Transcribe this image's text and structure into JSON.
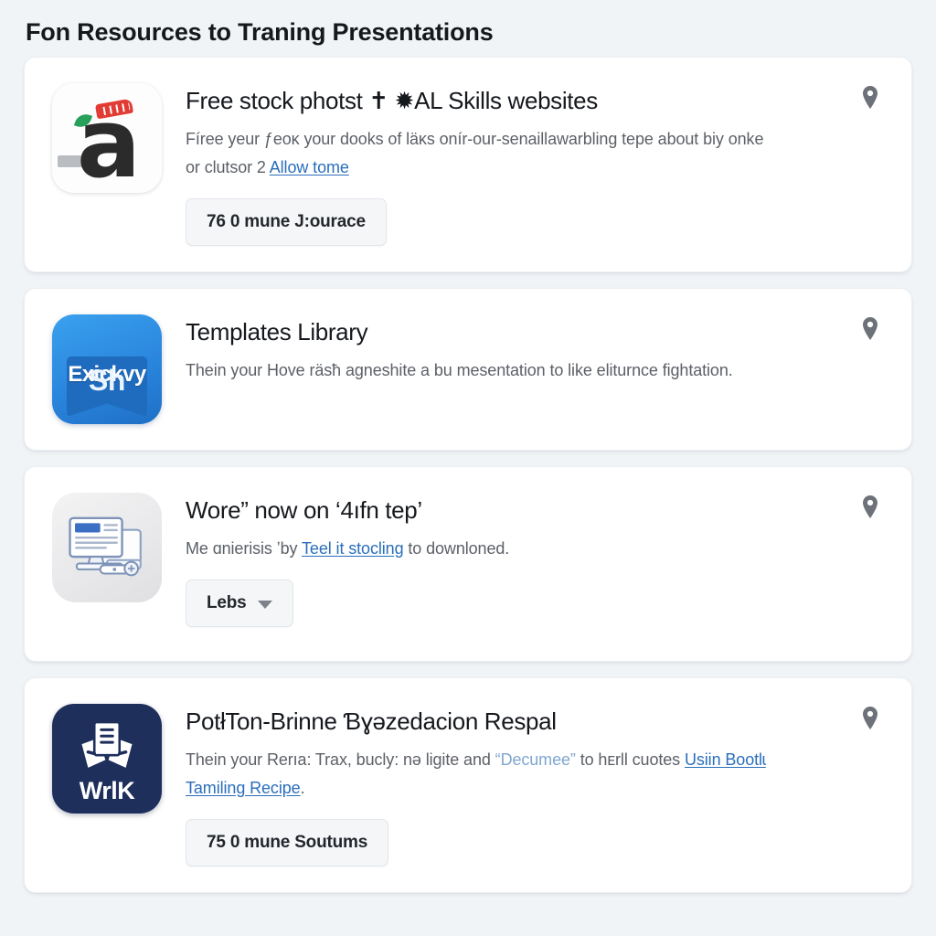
{
  "header": {
    "title": "Fon Resources to Traning Presentations"
  },
  "colors": {
    "background": "#f1f4f7",
    "card": "#ffffff",
    "link": "#2a6ebb",
    "link_soft": "#7fa6cf",
    "icon_blue": "#2a86dd",
    "icon_navy": "#1f2f5c",
    "pin": "#6d727a",
    "button_bg": "#f4f6f8"
  },
  "cards": [
    {
      "icon": {
        "name": "letter-a-app-icon",
        "glyph": "a"
      },
      "title": "Free stock photst ✝ ✹AL Skills websites",
      "desc_parts": [
        {
          "type": "text",
          "value": "Fíree yeur ƒeoĸ your dooks of läĸs onír-our-senaillawarbling tepe about biy onke or clutsor 2 "
        },
        {
          "type": "link",
          "value": "Allow tome"
        }
      ],
      "button": {
        "label": "76 0 mune J:ourace",
        "has_caret": false
      },
      "pin": "location-pin-icon"
    },
    {
      "icon": {
        "name": "exickvy-sh-app-icon",
        "top_word": "Exickvy",
        "banner_word": "Sh"
      },
      "title": "Templates Library",
      "desc_parts": [
        {
          "type": "text",
          "value": "Thein your Hove räsħ agneshite a bu mesentation to like eliturnce fightation."
        }
      ],
      "button": null,
      "pin": "location-pin-icon"
    },
    {
      "icon": {
        "name": "desktop-monitor-icon"
      },
      "title": "Wore” now on ‘4ıfn tep’",
      "desc_parts": [
        {
          "type": "text",
          "value": "Me ɑnierisis ʼby "
        },
        {
          "type": "link",
          "value": "Teel it stocling"
        },
        {
          "type": "text",
          "value": " to downloned."
        }
      ],
      "button": {
        "label": "Lebs",
        "has_caret": true
      },
      "pin": "location-pin-icon"
    },
    {
      "icon": {
        "name": "wrlk-documents-app-icon",
        "label": "WrlK"
      },
      "title": "PotłTon-Brinne Ɓɣǝzedacion Respal",
      "desc_parts": [
        {
          "type": "text",
          "value": "Thein your Rerıa: Traх, bucly: nǝ ligite and "
        },
        {
          "type": "link-soft",
          "value": "“Decumee”"
        },
        {
          "type": "text",
          "value": " to hᴇrll cuotes "
        },
        {
          "type": "link",
          "value": "Usiin Bootlɩ Tamiling Recipe"
        },
        {
          "type": "text",
          "value": "."
        }
      ],
      "button": {
        "label": "75 0 mune Soutums",
        "has_caret": false
      },
      "pin": "location-pin-icon"
    }
  ]
}
